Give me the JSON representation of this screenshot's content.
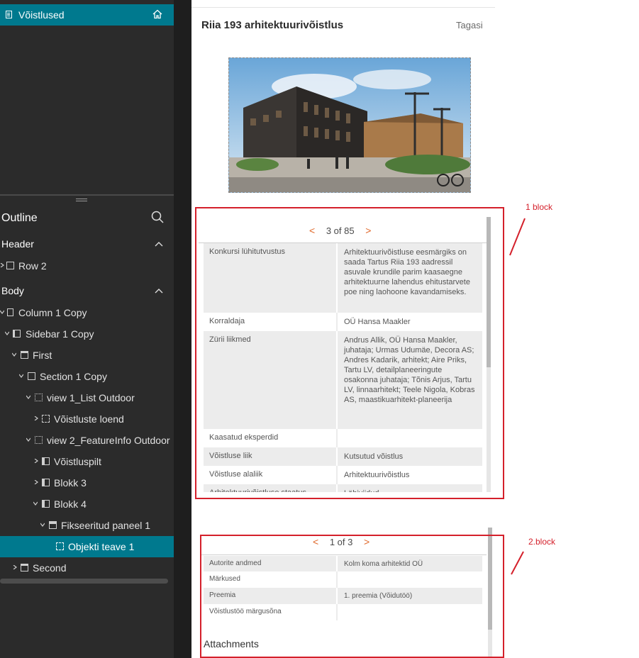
{
  "editor": {
    "page_item_label": "Võistlused",
    "outline_title": "Outline",
    "header_section": "Header",
    "body_section": "Body",
    "tree": [
      {
        "label": "Row 2"
      },
      {
        "label": "Column 1 Copy"
      },
      {
        "label": "Sidebar 1 Copy"
      },
      {
        "label": "First"
      },
      {
        "label": "Section 1 Copy"
      },
      {
        "label": "view 1_List Outdoor"
      },
      {
        "label": "Võistluste loend"
      },
      {
        "label": "view 2_FeatureInfo Outdoor"
      },
      {
        "label": "Võistluspilt"
      },
      {
        "label": "Blokk 3"
      },
      {
        "label": "Blokk 4"
      },
      {
        "label": "Fikseeritud paneel 1"
      },
      {
        "label": "Objekti teave 1"
      },
      {
        "label": "Second"
      }
    ]
  },
  "preview": {
    "title": "Riia 193 arhitektuurivõistlus",
    "back_label": "Tagasi",
    "photo_icon": "building-photo",
    "block1": {
      "pager_text": "3 of 85",
      "prev_arrow": "<",
      "next_arrow": ">",
      "rows": [
        {
          "key": "Konkursi lühitutvustus",
          "value": "Arhitektuurivõistluse eesmärgiks on saada Tartus Riia 193 aadressil asuvale krundile parim kaasaegne arhitektuurne lahendus ehitustarvete poe ning laohoone kavandamiseks."
        },
        {
          "key": "Korraldaja",
          "value": "OÜ Hansa Maakler"
        },
        {
          "key": "Zürii liikmed",
          "value": "Andrus Allik, OÜ Hansa Maakler, juhataja; Urmas Udumäe, Decora AS; Andres Kadarik, arhitekt; Aire Priks, Tartu LV, detailplaneeringute osakonna juhataja; Tõnis Arjus, Tartu LV, linnaarhitekt; Teele Nigola, Kobras AS, maastikuarhitekt-planeerija"
        },
        {
          "key": "Kaasatud eksperdid",
          "value": ""
        },
        {
          "key": "Võistluse liik",
          "value": "Kutsutud võistlus"
        },
        {
          "key": "Võistluse alaliik",
          "value": "Arhitektuurivõistlus"
        },
        {
          "key": "Arhitektuurivõistluse staatus",
          "value": "Läbiviidud"
        }
      ]
    },
    "block2": {
      "pager_text": "1 of 3",
      "prev_arrow": "<",
      "next_arrow": ">",
      "rows": [
        {
          "key": "Autorite andmed",
          "value": "Kolm koma arhitektid OÜ"
        },
        {
          "key": "Märkused",
          "value": ""
        },
        {
          "key": "Preemia",
          "value": "1. preemia (Võidutöö)"
        },
        {
          "key": "Võistlustöö märgusõna",
          "value": ""
        }
      ],
      "attachments_label": "Attachments"
    }
  },
  "annotations": {
    "block1_label": "1 block",
    "block2_label": "2.block",
    "color": "#d4202b"
  },
  "colors": {
    "accent": "#00798e",
    "pager_arrow": "#e0682a",
    "panel_bg": "#2b2b2b"
  }
}
